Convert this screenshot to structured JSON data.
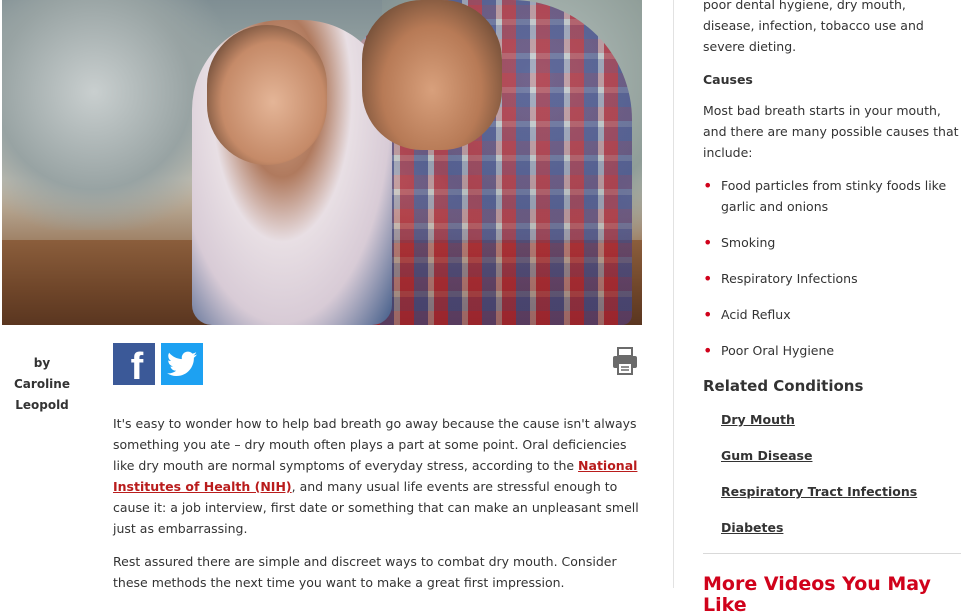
{
  "article": {
    "byline": "by Caroline Leopold",
    "paragraphs": {
      "p1_before": "It's easy to wonder how to help bad breath go away because the cause isn't always something you ate – dry mouth often plays a part at some point. Oral deficiencies like dry mouth are normal symptoms of everyday stress, according to the ",
      "p1_link": "National Institutes of Health (NIH)",
      "p1_after": ", and many usual life events are stressful enough to cause it: a job interview, first date or something that can make an unpleasant smell just as embarrassing.",
      "p2": "Rest assured there are simple and discreet ways to combat dry mouth. Consider these methods the next time you want to make a great first impression."
    },
    "share": {
      "facebook_icon": "facebook-icon",
      "twitter_icon": "twitter-icon",
      "print_icon": "printer-icon"
    }
  },
  "sidebar": {
    "intro": "poor dental hygiene, dry mouth, disease, infection, tobacco use and severe dieting.",
    "causes_heading": "Causes",
    "causes_text": "Most bad breath starts in your mouth, and there are many possible causes that include:",
    "causes": [
      "Food particles from stinky foods like garlic and onions",
      "Smoking",
      "Respiratory Infections",
      "Acid Reflux",
      "Poor Oral Hygiene"
    ],
    "related_heading": "Related Conditions",
    "related": [
      "Dry Mouth",
      "Gum Disease",
      "Respiratory Tract Infections",
      "Diabetes"
    ],
    "more_videos_heading": "More Videos You May Like"
  },
  "colors": {
    "accent": "#d0021b",
    "facebook": "#3b5998",
    "twitter": "#1da1f2"
  }
}
